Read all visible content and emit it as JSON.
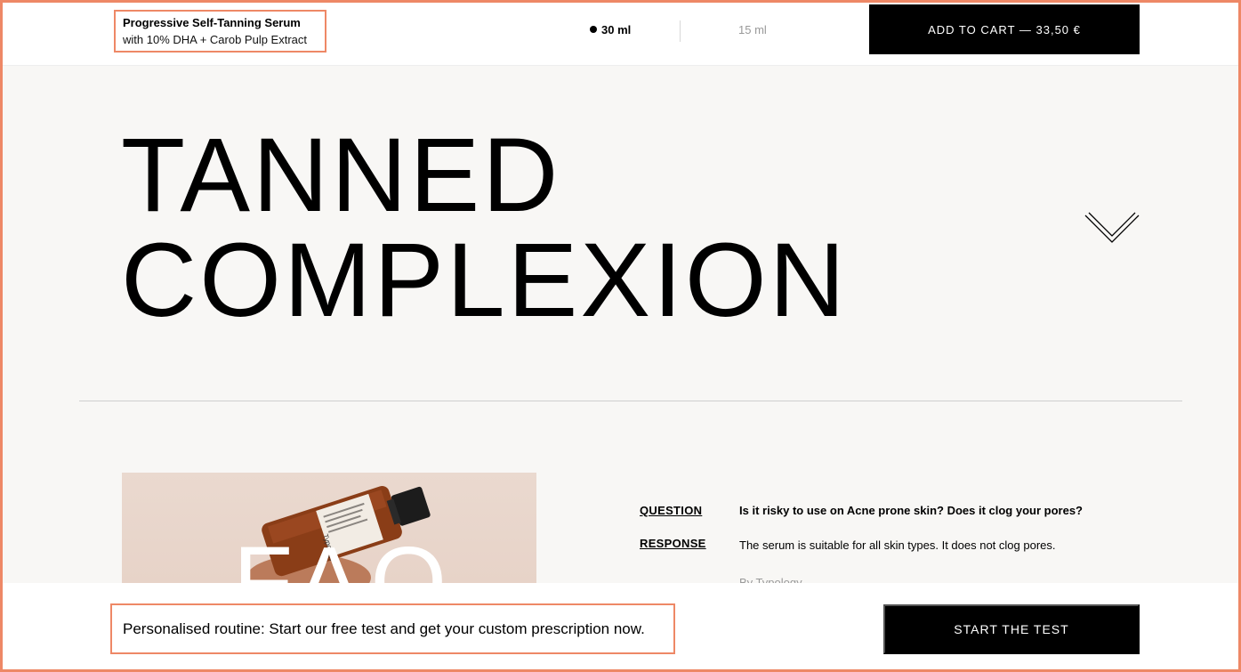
{
  "topbar": {
    "product_name": "Progressive Self-Tanning Serum",
    "product_subtitle": "with 10% DHA + Carob Pulp Extract",
    "sizes": [
      {
        "label": "30 ml",
        "selected": true
      },
      {
        "label": "15 ml",
        "selected": false
      }
    ],
    "add_to_cart_label": "ADD TO CART — 33,50 €"
  },
  "hero": {
    "title_line1": "TANNED",
    "title_line2": "COMPLEXION",
    "expand_icon": "chevron-down-icon"
  },
  "faq": {
    "image_overlay_text": "FAQ",
    "bottle_brand": "Typology",
    "question_label": "QUESTION",
    "question_text": "Is it risky to use on Acne prone skin? Does it clog your pores?",
    "response_label": "RESPONSE",
    "response_text": "The serum is suitable for all skin types. It does not clog pores.",
    "author": "By Typology"
  },
  "bottombar": {
    "routine_text": "Personalised routine: Start our free test and get your custom prescription now.",
    "start_button_label": "START THE TEST"
  },
  "colors": {
    "highlight": "#ee8866",
    "background": "#f8f7f5",
    "button": "#000000"
  }
}
